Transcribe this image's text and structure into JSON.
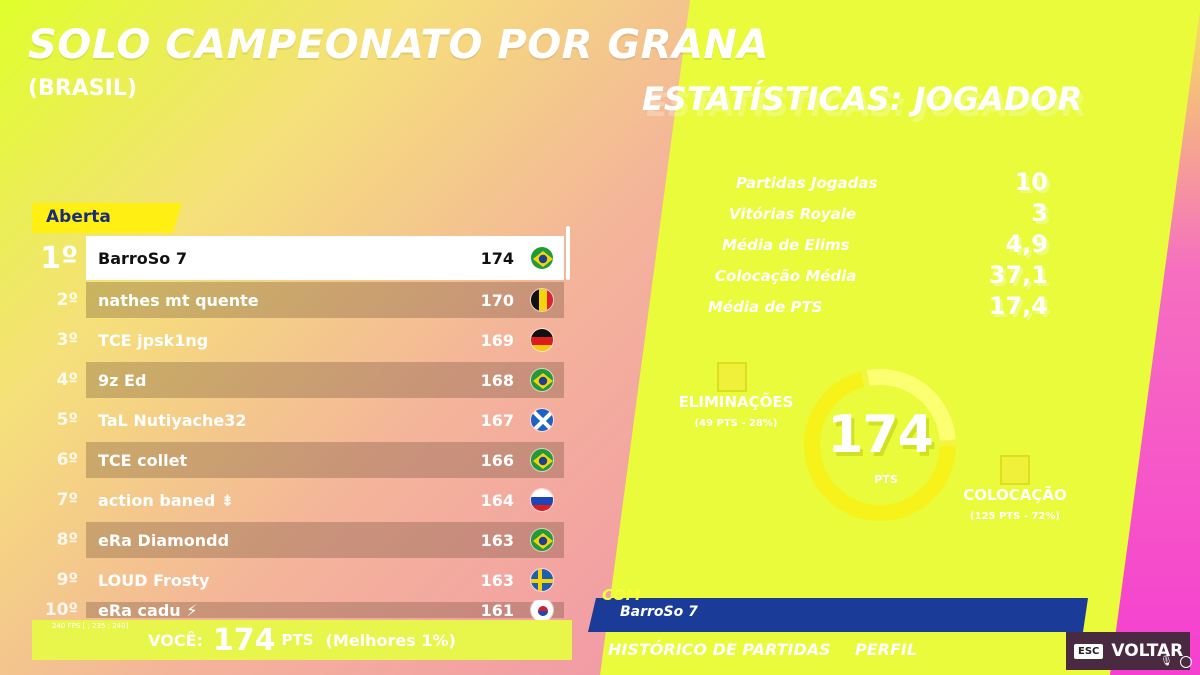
{
  "header": {
    "title": "SOLO CAMPEONATO POR GRANA",
    "subtitle": "(BRASIL)",
    "stats_title": "ESTATÍSTICAS: JOGADOR"
  },
  "leaderboard": {
    "tab_label": "Aberta",
    "rows": [
      {
        "rank": "1º",
        "name": "BarroSo 7",
        "points": "174",
        "flag": "brazil-flag-icon"
      },
      {
        "rank": "2º",
        "name": "nathes mt quente",
        "points": "170",
        "flag": "belgium-flag-icon"
      },
      {
        "rank": "3º",
        "name": "TCE jpsk1ng",
        "points": "169",
        "flag": "germany-flag-icon"
      },
      {
        "rank": "4º",
        "name": "9z Ed",
        "points": "168",
        "flag": "brazil-flag-icon"
      },
      {
        "rank": "5º",
        "name": "TaL Nutiyache32",
        "points": "167",
        "flag": "scotland-flag-icon"
      },
      {
        "rank": "6º",
        "name": "TCE collet",
        "points": "166",
        "flag": "brazil-flag-icon"
      },
      {
        "rank": "7º",
        "name": "action baned ⇟",
        "points": "164",
        "flag": "russia-flag-icon"
      },
      {
        "rank": "8º",
        "name": "eRa Diamondd",
        "points": "163",
        "flag": "brazil-flag-icon"
      },
      {
        "rank": "9º",
        "name": "LOUD Frosty",
        "points": "163",
        "flag": "sweden-flag-icon"
      },
      {
        "rank": "10º",
        "name": "eRa cadu ⚡",
        "points": "161",
        "flag": "south-korea-flag-icon"
      }
    ]
  },
  "you": {
    "fps": "240 FPS [ ; 235 ; 240]",
    "label": "VOCÊ:",
    "points": "174",
    "unit": "PTS",
    "rank": "(Melhores 1%)"
  },
  "stats": [
    {
      "label": "Partidas Jogadas",
      "value": "10"
    },
    {
      "label": "Vitórias Royale",
      "value": "3"
    },
    {
      "label": "Média de Elims",
      "value": "4,9"
    },
    {
      "label": "Colocação Média",
      "value": "37,1"
    },
    {
      "label": "Média de PTS",
      "value": "17,4"
    }
  ],
  "score_ring": {
    "points": "174",
    "unit": "PTS",
    "elim_fraction": 0.28,
    "place_fraction": 0.72,
    "eliminations_label": "ELIMINAÇÕES",
    "eliminations_sub": "(49 PTS - 28%)",
    "placement_label": "COLOCAÇÃO",
    "placement_sub": "(125 PTS - 72%)"
  },
  "player_banner": {
    "tag": "COM",
    "name": "BarroSo 7"
  },
  "nav": {
    "history": "HISTÓRICO DE PARTIDAS",
    "profile": "PERFIL",
    "esc": "ESC",
    "back": "VOLTAR"
  }
}
